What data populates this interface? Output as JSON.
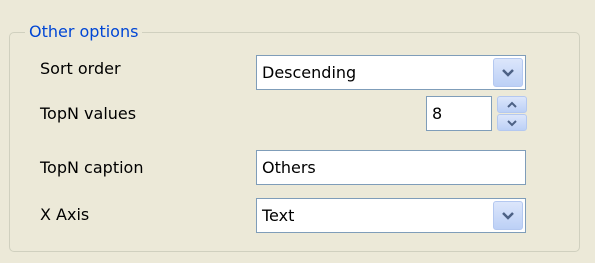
{
  "group": {
    "title": "Other options"
  },
  "fields": {
    "sort_order": {
      "label": "Sort order",
      "value": "Descending",
      "icon": "chevron-down-icon"
    },
    "topn_values": {
      "label": "TopN values",
      "value": "8",
      "up_icon": "chevron-up-icon",
      "down_icon": "chevron-down-icon"
    },
    "topn_caption": {
      "label": "TopN caption",
      "value": "Others"
    },
    "x_axis": {
      "label": "X Axis",
      "value": "Text",
      "icon": "chevron-down-icon"
    }
  },
  "colors": {
    "background": "#ece9d8",
    "legend_text": "#0046d5",
    "field_border": "#7f9db9",
    "dropdown_button": "#c7d7f8",
    "arrow": "#4d6185"
  }
}
